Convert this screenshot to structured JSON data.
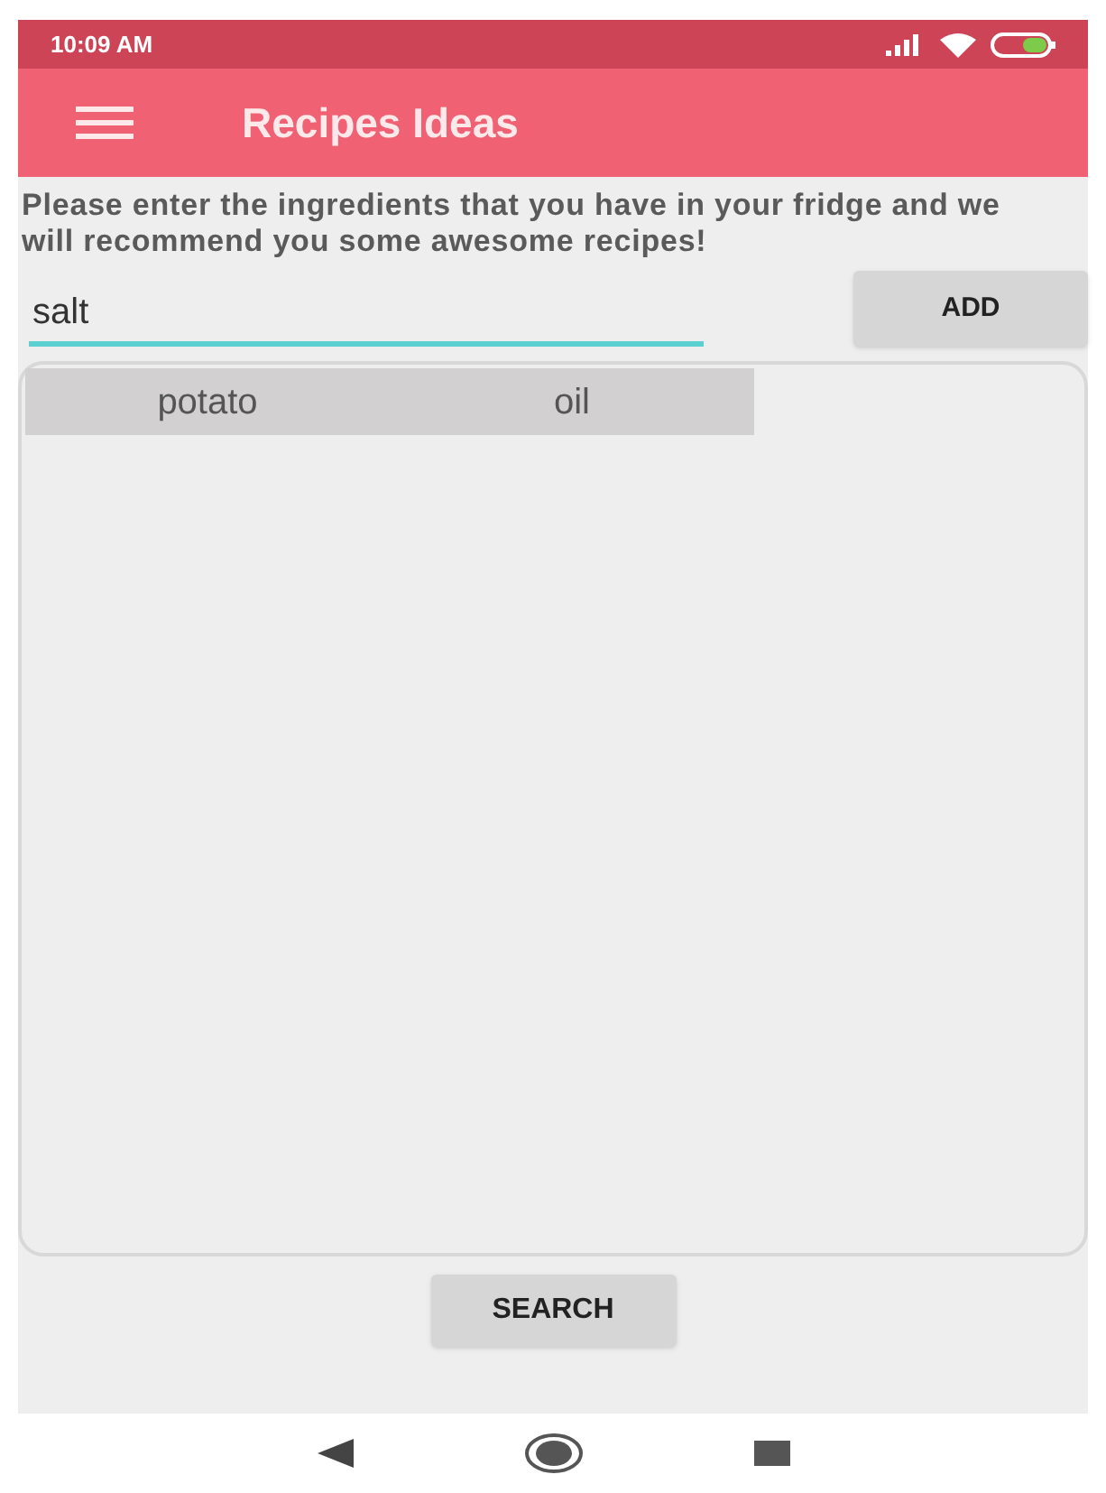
{
  "status_bar": {
    "time": "10:09 AM"
  },
  "app_bar": {
    "title": "Recipes Ideas"
  },
  "instructions": "Please enter the ingredients that you have in your fridge and we will recommend you some awesome recipes!",
  "ingredient_field": {
    "value": "salt"
  },
  "add_button": "ADD",
  "ingredients": [
    "potato",
    "oil"
  ],
  "search_button": "SEARCH"
}
